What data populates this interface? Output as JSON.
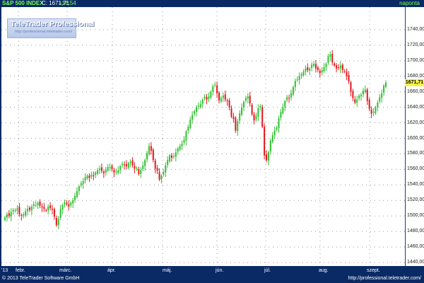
{
  "header": {
    "title": "S&P 500 INDEX",
    "last": "C: 1671,71",
    "change": "+16,54",
    "period": "naponta"
  },
  "logo": {
    "main": "TeleTrader Professional",
    "sub": "http://professional.teletrader.com/"
  },
  "footer": {
    "copyright": "© 2013 TeleTrader Software GmbH",
    "url": "http://professional.teletrader.com/"
  },
  "colors": {
    "up": "#2fbf2f",
    "down": "#e2161b",
    "frame": "#0a2a66",
    "grid": "#9a9a9a"
  },
  "chart_data": {
    "type": "candlestick",
    "x_tick_labels": [
      "'13",
      "febr.",
      "márc.",
      "ápr.",
      "máj.",
      "jún.",
      "júl.",
      "aug.",
      "szept."
    ],
    "y_ticks": [
      "1440,00",
      "1460,00",
      "1480,00",
      "1500,00",
      "1520,00",
      "1540,00",
      "1560,00",
      "1580,00",
      "1600,00",
      "1620,00",
      "1640,00",
      "1660,00",
      "1680,00",
      "1700,00",
      "1720,00",
      "1740,00"
    ],
    "ylim": [
      1440,
      1750
    ],
    "last_price_label": "1671,71",
    "grid": true,
    "closes": [
      1498,
      1502,
      1500,
      1505,
      1508,
      1507,
      1510,
      1502,
      1500,
      1502,
      1506,
      1509,
      1508,
      1512,
      1515,
      1514,
      1517,
      1513,
      1511,
      1509,
      1507,
      1512,
      1510,
      1508,
      1499,
      1488,
      1496,
      1509,
      1514,
      1518,
      1515,
      1512,
      1517,
      1520,
      1526,
      1532,
      1538,
      1542,
      1545,
      1550,
      1552,
      1549,
      1553,
      1552,
      1556,
      1559,
      1561,
      1558,
      1555,
      1560,
      1563,
      1563,
      1560,
      1556,
      1557,
      1559,
      1564,
      1567,
      1566,
      1564,
      1568,
      1570,
      1565,
      1561,
      1562,
      1554,
      1559,
      1565,
      1572,
      1581,
      1590,
      1584,
      1572,
      1561,
      1558,
      1547,
      1552,
      1557,
      1565,
      1572,
      1578,
      1575,
      1577,
      1582,
      1587,
      1590,
      1593,
      1598,
      1609,
      1615,
      1624,
      1630,
      1635,
      1640,
      1642,
      1644,
      1650,
      1654,
      1650,
      1654,
      1660,
      1667,
      1669,
      1658,
      1649,
      1652,
      1655,
      1650,
      1648,
      1640,
      1628,
      1625,
      1610,
      1622,
      1632,
      1640,
      1647,
      1652,
      1654,
      1645,
      1631,
      1623,
      1629,
      1639,
      1642,
      1615,
      1578,
      1572,
      1582,
      1597,
      1604,
      1610,
      1614,
      1626,
      1634,
      1640,
      1648,
      1653,
      1652,
      1658,
      1666,
      1674,
      1676,
      1680,
      1683,
      1686,
      1690,
      1688,
      1690,
      1695,
      1696,
      1690,
      1688,
      1684,
      1688,
      1692,
      1696,
      1706,
      1708,
      1698,
      1694,
      1690,
      1691,
      1694,
      1688,
      1686,
      1680,
      1673,
      1660,
      1652,
      1646,
      1650,
      1655,
      1656,
      1661,
      1663,
      1648,
      1638,
      1632,
      1634,
      1640,
      1646,
      1653,
      1658,
      1668,
      1671.71
    ]
  }
}
